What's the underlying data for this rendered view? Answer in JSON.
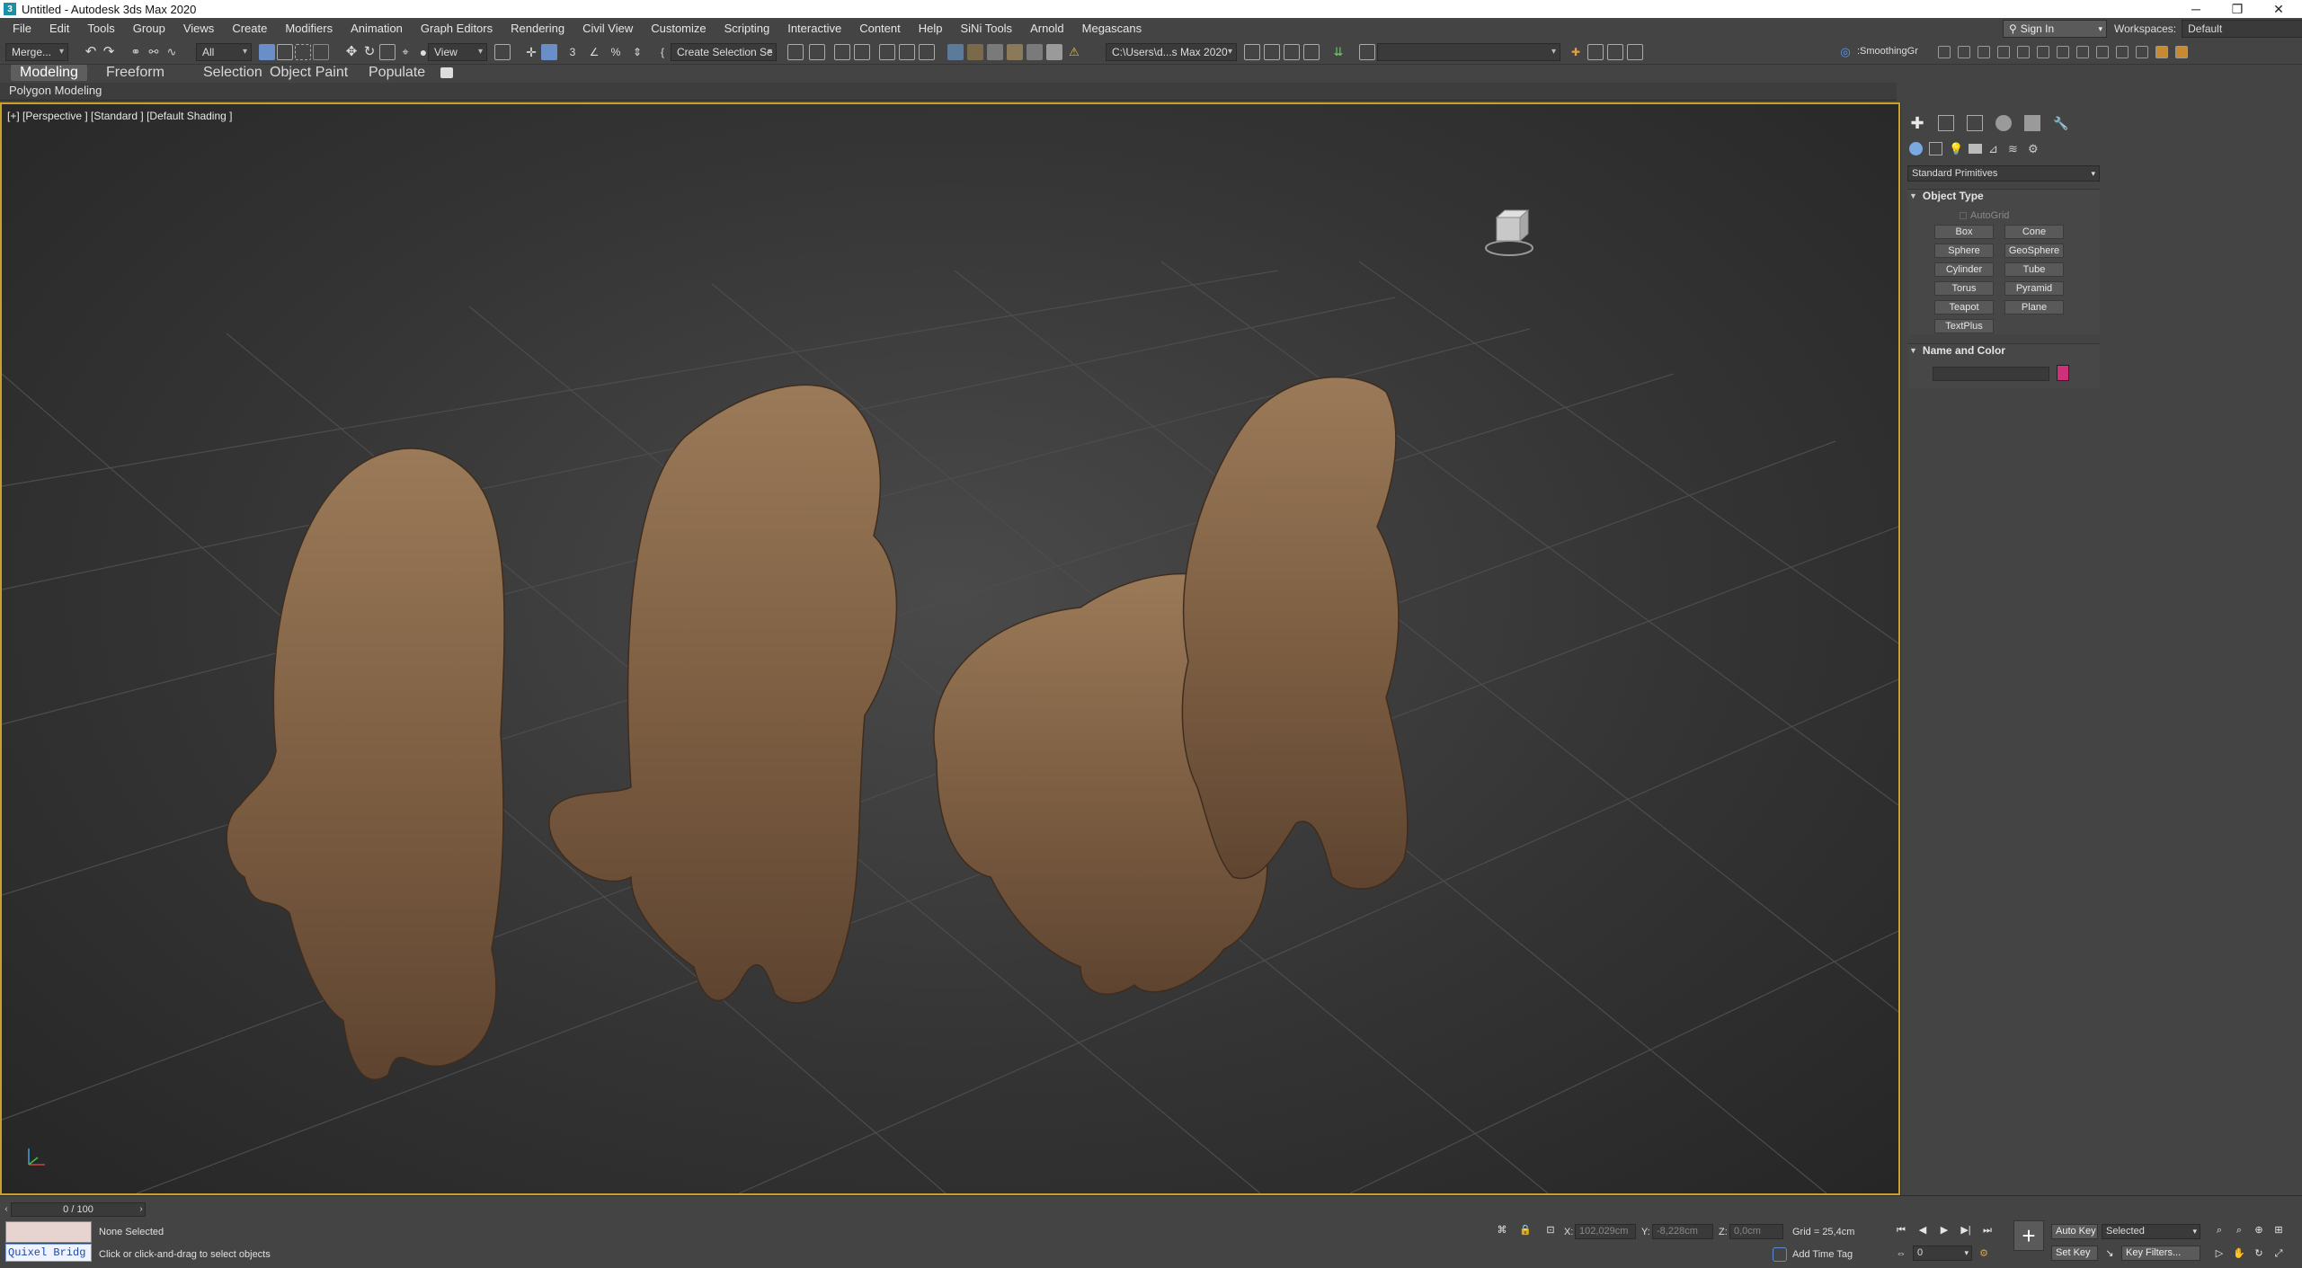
{
  "window": {
    "title": "Untitled - Autodesk 3ds Max 2020",
    "icon_letter": "3",
    "controls": {
      "minimize": "─",
      "restore": "❐",
      "close": "✕"
    }
  },
  "menu": [
    "File",
    "Edit",
    "Tools",
    "Group",
    "Views",
    "Create",
    "Modifiers",
    "Animation",
    "Graph Editors",
    "Rendering",
    "Civil View",
    "Customize",
    "Scripting",
    "Interactive",
    "Content",
    "Help",
    "SiNi Tools",
    "Arnold",
    "Megascans"
  ],
  "account": {
    "sign_in": "Sign In",
    "workspaces_label": "Workspaces:",
    "workspace_value": "Default"
  },
  "toolbar": {
    "merge_label": "Merge...",
    "selection_filter": "All",
    "ref_coord": "View",
    "named_selection": "Create Selection Se",
    "project_path": "C:\\Users\\d...s Max 2020",
    "smoothing_label": ":SmoothingGr"
  },
  "ribbon": {
    "tabs": [
      "Modeling",
      "Freeform",
      "Selection",
      "Object Paint",
      "Populate"
    ],
    "active": "Modeling",
    "panel_label": "Polygon Modeling"
  },
  "viewport": {
    "label": "[+] [Perspective ] [Standard ] [Default Shading ]",
    "active_border": "#c9a227",
    "lion_color": "#8a6a4a"
  },
  "command_panel": {
    "category_dropdown": "Standard Primitives",
    "object_type_header": "Object Type",
    "autogrid_label": "AutoGrid",
    "primitives": [
      "Box",
      "Cone",
      "Sphere",
      "GeoSphere",
      "Cylinder",
      "Tube",
      "Torus",
      "Pyramid",
      "Teapot",
      "Plane",
      "TextPlus"
    ],
    "name_color_header": "Name and Color",
    "object_color": "#d0307a"
  },
  "timeline": {
    "frame_display": "0 / 100"
  },
  "status": {
    "quixel_label": "Quixel Bridg",
    "selection_status": "None Selected",
    "prompt": "Click or click-and-drag to select objects"
  },
  "coords": {
    "x_label": "X:",
    "x_value": "102,029cm",
    "y_label": "Y:",
    "y_value": "-8,228cm",
    "z_label": "Z:",
    "z_value": "0,0cm",
    "grid": "Grid = 25,4cm",
    "add_time_tag": "Add Time Tag"
  },
  "anim": {
    "auto_key": "Auto Key",
    "set_key": "Set Key",
    "key_mode": "Selected",
    "key_filters": "Key Filters...",
    "current_frame": "0"
  }
}
